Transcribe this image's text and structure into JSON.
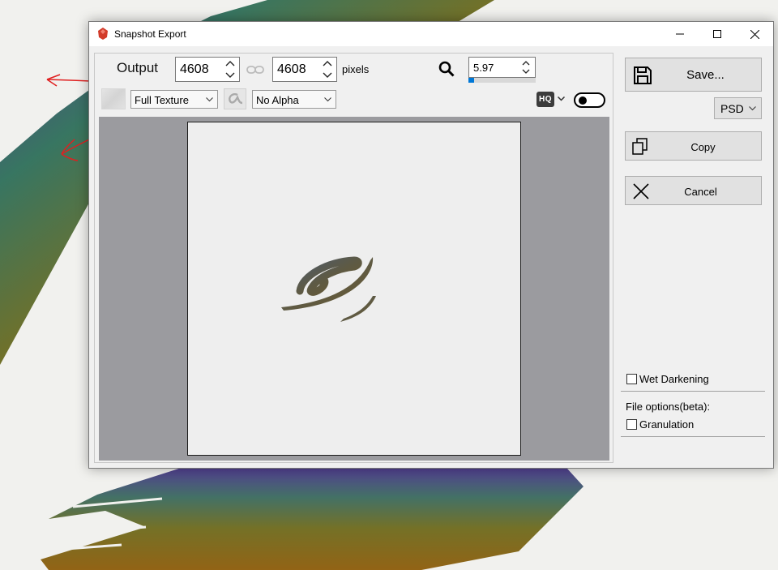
{
  "window": {
    "title": "Snapshot Export",
    "controls": [
      "minimize-icon",
      "maximize-icon",
      "close-icon"
    ]
  },
  "output": {
    "label": "Output",
    "width": "4608",
    "height": "4608",
    "unit_label": "pixels",
    "zoom": "5.97",
    "zoom_progress": 0.08
  },
  "options": {
    "texture_mode": "Full Texture",
    "alpha_mode": "No Alpha",
    "hq_label": "HQ",
    "hq_toggle_on": false
  },
  "actions": {
    "save_label": "Save...",
    "format": "PSD",
    "copy_label": "Copy",
    "cancel_label": "Cancel"
  },
  "settings": {
    "wet_darkening_label": "Wet Darkening",
    "wet_darkening_checked": false,
    "file_options_label": "File options(beta):",
    "granulation_label": "Granulation",
    "granulation_checked": false
  },
  "colors": {
    "annotation": "#e02020",
    "preview_bg": "#9b9b9f",
    "zoom_progress": "#0078d7"
  }
}
